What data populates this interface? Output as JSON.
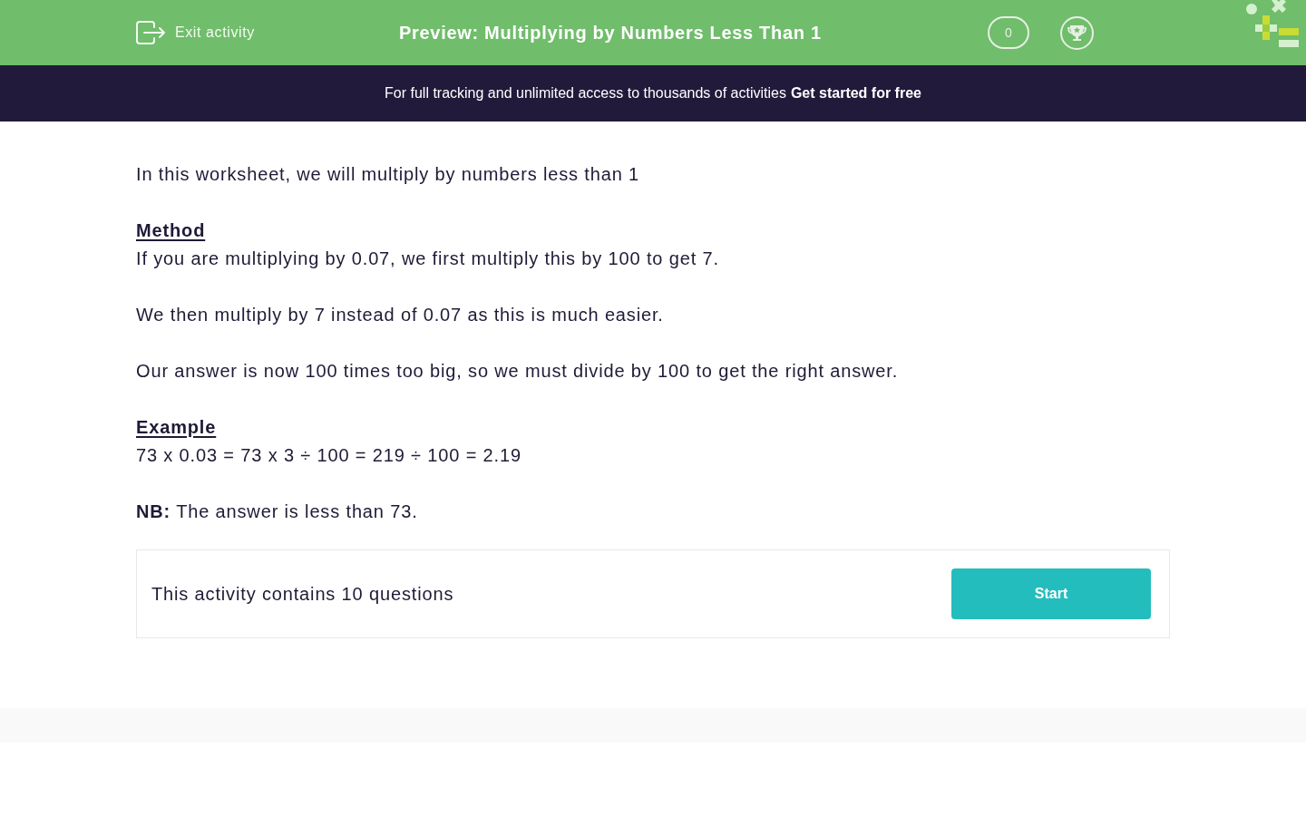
{
  "header": {
    "exit_label": "Exit activity",
    "title": "Preview: Multiplying by Numbers Less Than 1",
    "score": "0"
  },
  "banner": {
    "text": "For full tracking and unlimited access to thousands of activities",
    "link": "Get started for free"
  },
  "content": [
    {
      "kind": "paragraph",
      "text": "In this worksheet, we will multiply by numbers less than 1"
    },
    {
      "kind": "heading",
      "text": "Method"
    },
    {
      "kind": "paragraph",
      "text": "If you are multiplying by 0.07, we first multiply this by 100 to get 7."
    },
    {
      "kind": "paragraph",
      "text": "We then multiply by 7 instead of 0.07 as this is much easier."
    },
    {
      "kind": "paragraph",
      "text": "Our answer is now 100 times too big, so we must divide by 100 to get the right answer."
    },
    {
      "kind": "heading",
      "text": "Example"
    },
    {
      "kind": "paragraph",
      "text": "73 x 0.03 = 73 x 3 ÷ 100 = 219 ÷ 100 = 2.19"
    },
    {
      "kind": "paragraph",
      "text": "**NB:** The answer is less than 73."
    }
  ],
  "activity": {
    "text": "This activity contains 10 questions",
    "button": "Start"
  }
}
